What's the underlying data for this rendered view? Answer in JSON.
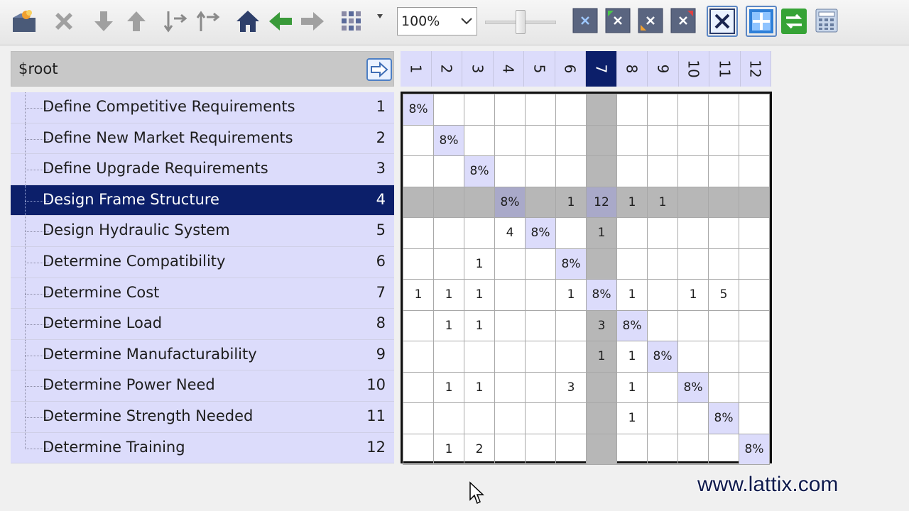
{
  "toolbar": {
    "buttons": [
      {
        "name": "open-project-icon",
        "icon": "folder"
      },
      {
        "name": "delete-icon",
        "icon": "x"
      },
      {
        "name": "move-down-icon",
        "icon": "arrow-down"
      },
      {
        "name": "move-up-icon",
        "icon": "arrow-up"
      },
      {
        "name": "expand-icon",
        "icon": "expand"
      },
      {
        "name": "collapse-icon",
        "icon": "collapse"
      },
      {
        "name": "home-icon",
        "icon": "home"
      },
      {
        "name": "back-icon",
        "icon": "arrow-left"
      },
      {
        "name": "forward-icon",
        "icon": "arrow-right"
      },
      {
        "name": "partition-icon",
        "icon": "grid"
      }
    ],
    "zoom_value": "100%",
    "zoom_level_fraction": 0.5,
    "accent": "#4a6fa8"
  },
  "outline": {
    "root_label": "$root",
    "items": [
      {
        "label": "Define Competitive Requirements",
        "index": "1"
      },
      {
        "label": "Define New Market Requirements",
        "index": "2"
      },
      {
        "label": "Define Upgrade Requirements",
        "index": "3"
      },
      {
        "label": "Design Frame Structure",
        "index": "4"
      },
      {
        "label": "Design Hydraulic System",
        "index": "5"
      },
      {
        "label": "Determine Compatibility",
        "index": "6"
      },
      {
        "label": "Determine Cost",
        "index": "7"
      },
      {
        "label": "Determine Load",
        "index": "8"
      },
      {
        "label": "Determine Manufacturability",
        "index": "9"
      },
      {
        "label": "Determine Power Need",
        "index": "10"
      },
      {
        "label": "Determine Strength Needed",
        "index": "11"
      },
      {
        "label": "Determine Training",
        "index": "12"
      }
    ],
    "selected_row": 4
  },
  "matrix": {
    "columns": [
      "1",
      "2",
      "3",
      "4",
      "5",
      "6",
      "7",
      "8",
      "9",
      "10",
      "11",
      "12"
    ],
    "selected_column": 7,
    "diagonal_label": "8%",
    "rows": [
      [
        "8%",
        "",
        "",
        "",
        "",
        "",
        "",
        "",
        "",
        "",
        "",
        ""
      ],
      [
        "",
        "8%",
        "",
        "",
        "",
        "",
        "",
        "",
        "",
        "",
        "",
        ""
      ],
      [
        "",
        "",
        "8%",
        "",
        "",
        "",
        "",
        "",
        "",
        "",
        "",
        ""
      ],
      [
        "",
        "",
        "",
        "8%",
        "",
        "1",
        "12",
        "1",
        "1",
        "",
        "",
        ""
      ],
      [
        "",
        "",
        "",
        "4",
        "8%",
        "",
        "1",
        "",
        "",
        "",
        "",
        ""
      ],
      [
        "",
        "",
        "1",
        "",
        "",
        "8%",
        "",
        "",
        "",
        "",
        "",
        ""
      ],
      [
        "1",
        "1",
        "1",
        "",
        "",
        "1",
        "8%",
        "1",
        "",
        "1",
        "5",
        ""
      ],
      [
        "",
        "1",
        "1",
        "",
        "",
        "",
        "3",
        "8%",
        "",
        "",
        "",
        ""
      ],
      [
        "",
        "",
        "",
        "",
        "",
        "",
        "1",
        "1",
        "8%",
        "",
        "",
        ""
      ],
      [
        "",
        "1",
        "1",
        "",
        "",
        "3",
        "",
        "1",
        "",
        "8%",
        "",
        ""
      ],
      [
        "",
        "",
        "",
        "",
        "",
        "",
        "",
        "1",
        "",
        "",
        "8%",
        ""
      ],
      [
        "",
        "1",
        "2",
        "",
        "",
        "",
        "",
        "",
        "",
        "",
        "",
        "8%"
      ]
    ]
  },
  "watermark": "www.lattix.com"
}
